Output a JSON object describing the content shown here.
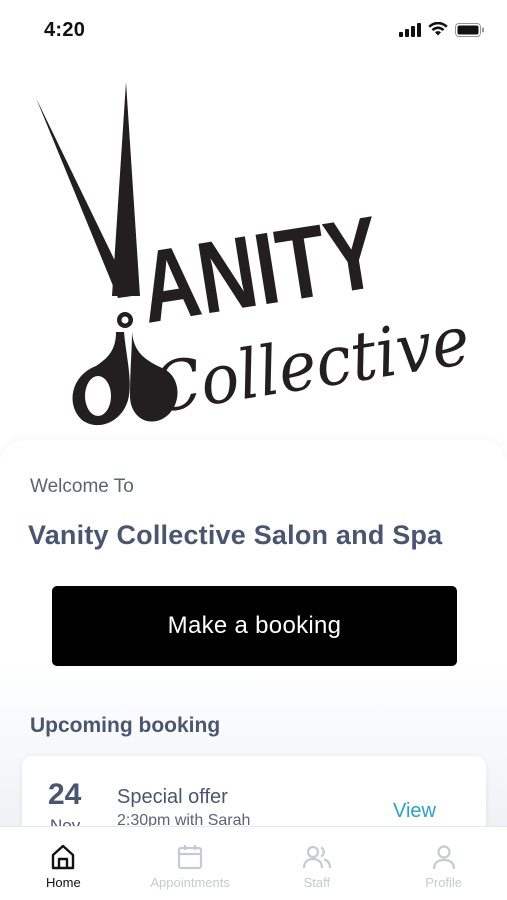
{
  "status_bar": {
    "time": "4:20"
  },
  "logo": {
    "line1": "ANITY",
    "line2": "Collective"
  },
  "welcome": {
    "label": "Welcome To",
    "salon_name": "Vanity Collective Salon and Spa",
    "booking_button": "Make a booking"
  },
  "upcoming": {
    "title": "Upcoming booking",
    "day": "24",
    "month": "Nov",
    "booking_title": "Special offer",
    "booking_detail": "2:30pm with Sarah",
    "view_label": "View"
  },
  "tabs": [
    {
      "label": "Home",
      "icon": "home-icon"
    },
    {
      "label": "Appointments",
      "icon": "calendar-icon"
    },
    {
      "label": "Staff",
      "icon": "people-icon"
    },
    {
      "label": "Profile",
      "icon": "user-icon"
    }
  ],
  "colors": {
    "accent": "#2aa1c5",
    "heading": "#4a5670",
    "button": "#000000"
  }
}
